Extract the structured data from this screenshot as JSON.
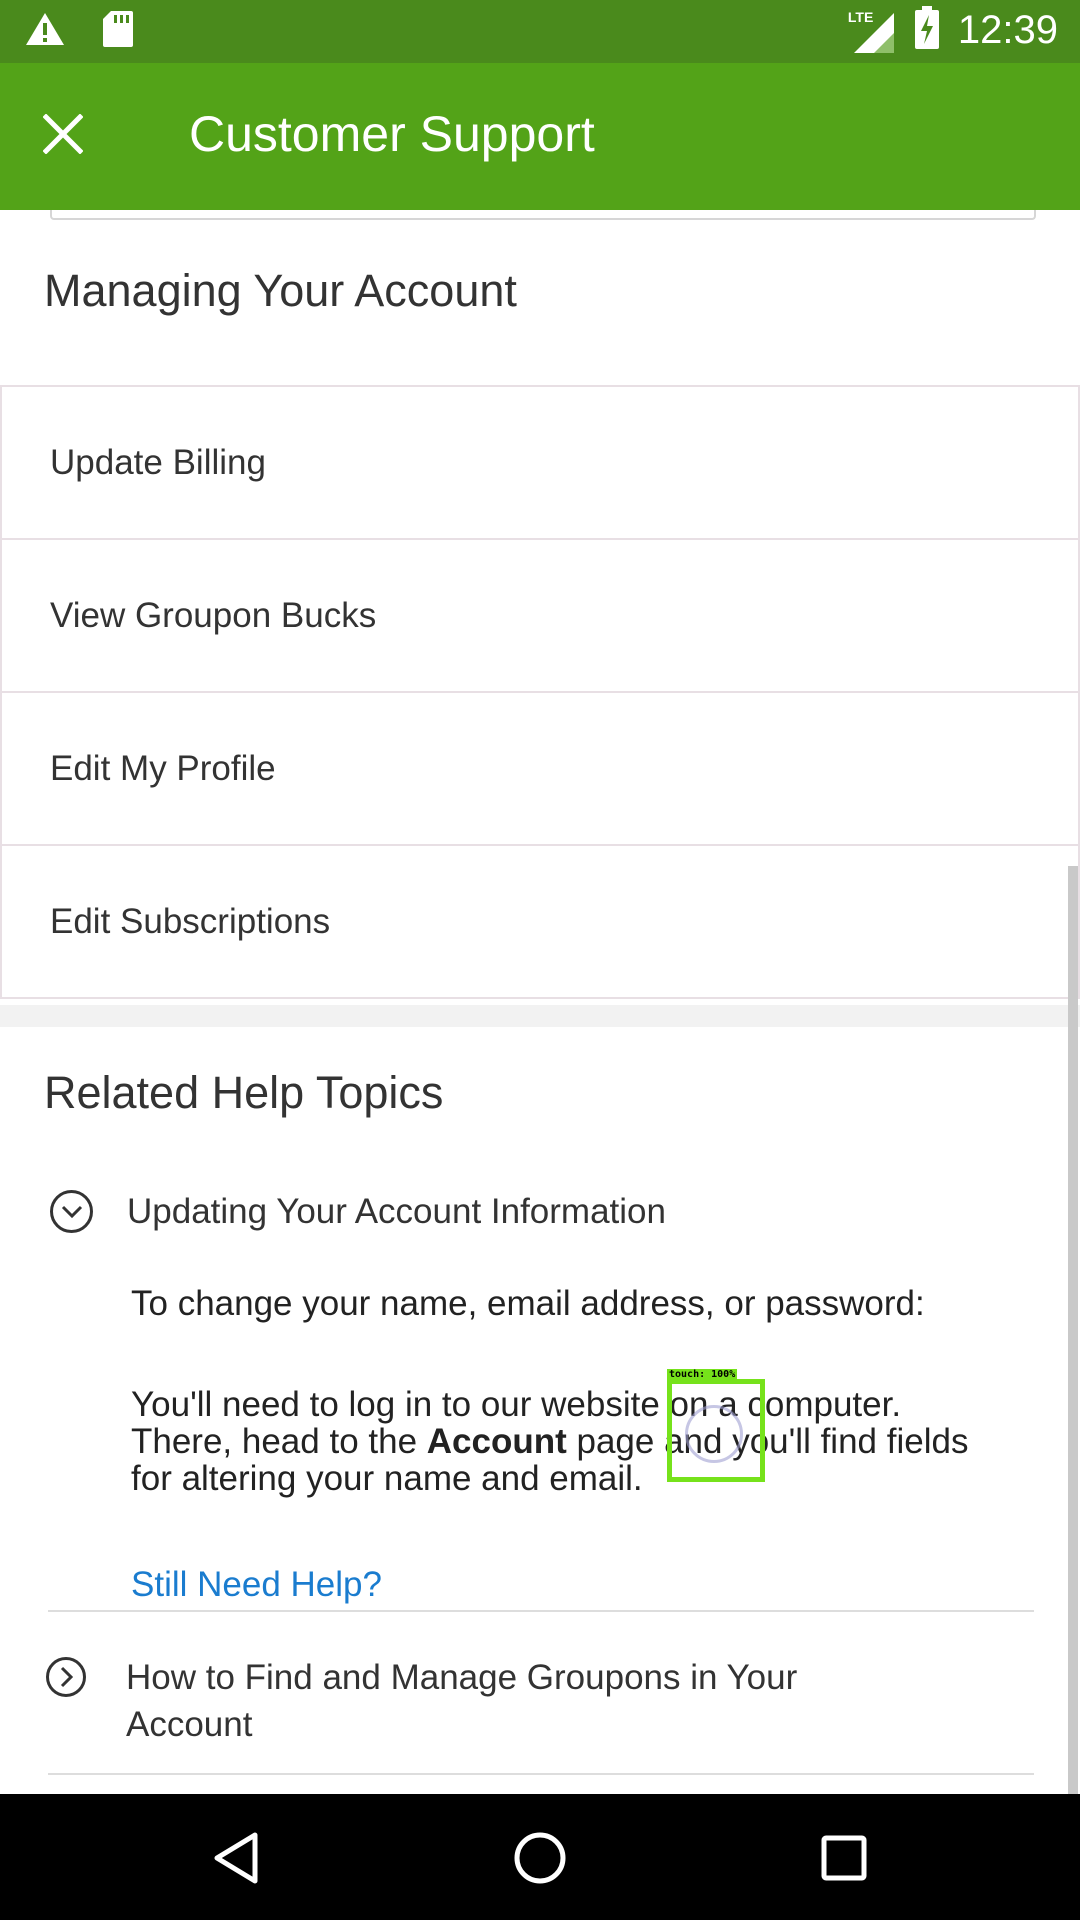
{
  "status_bar": {
    "time": "12:39",
    "network_label": "LTE",
    "icons": [
      "warning-icon",
      "sd-card-icon",
      "lte-signal-icon",
      "battery-charging-icon"
    ]
  },
  "app_bar": {
    "title": "Customer Support",
    "close_icon": "close-icon"
  },
  "managing": {
    "title": "Managing Your Account",
    "items": [
      {
        "label": "Update Billing"
      },
      {
        "label": "View Groupon Bucks"
      },
      {
        "label": "Edit My Profile"
      },
      {
        "label": "Edit Subscriptions"
      }
    ]
  },
  "related": {
    "title": "Related Help Topics",
    "topics": [
      {
        "title": "Updating Your Account Information",
        "expanded": true,
        "icon": "chevron-down-circle-icon",
        "answer_intro": "To change your name, email address, or password:",
        "answer_part1": "You'll need to log in to our website on a computer. There, head to the ",
        "answer_bold": "Account",
        "answer_part2": " page and you'll find fields for altering your name and email.",
        "link": "Still Need Help?"
      },
      {
        "title": "How to Find and Manage Groupons in Your Account",
        "expanded": false,
        "icon": "chevron-right-circle-icon"
      }
    ]
  },
  "touch_overlay": {
    "label": "touch: 100%"
  },
  "nav_bar": {
    "icons": [
      "back-icon",
      "home-icon",
      "recents-icon"
    ]
  },
  "colors": {
    "status_bar": "#4a8a1c",
    "app_bar": "#53a318",
    "link": "#1a7ccf",
    "touch": "#76e21b"
  }
}
